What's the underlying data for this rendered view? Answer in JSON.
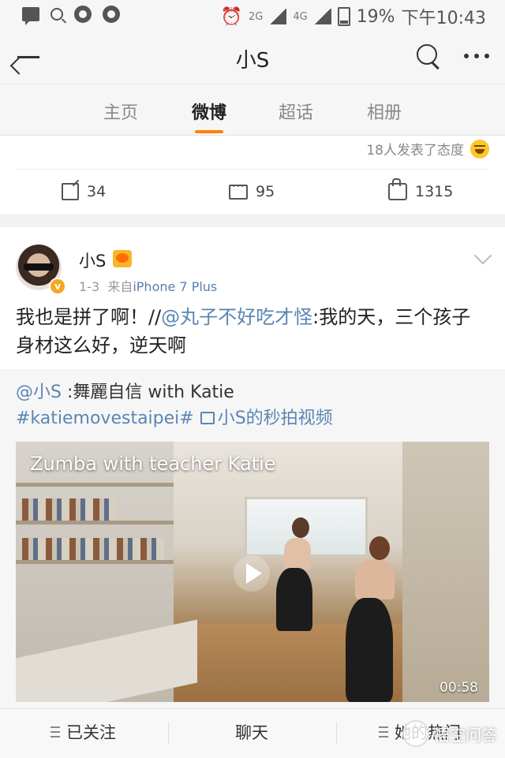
{
  "status_bar": {
    "network_2g": "2G",
    "network_4g": "4G",
    "battery": "19%",
    "time": "下午10:43"
  },
  "title_bar": {
    "title": "小S"
  },
  "tabs": [
    {
      "label": "主页",
      "active": false
    },
    {
      "label": "微博",
      "active": true
    },
    {
      "label": "超话",
      "active": false
    },
    {
      "label": "相册",
      "active": false
    }
  ],
  "prev_post": {
    "reactions_text": "18人发表了态度",
    "repost_count": "34",
    "comment_count": "95",
    "like_count": "1315"
  },
  "post": {
    "author": "小S",
    "date": "1-3",
    "source_prefix": "来自",
    "source": "iPhone 7 Plus",
    "text_before": "我也是拼了啊！//",
    "mention": "@丸子不好吃才怪",
    "text_after": ":我的天，三个孩子身材这么好，逆天啊"
  },
  "repost": {
    "mention": "@小S",
    "text": " :舞麗自信 with Katie",
    "hashtag": "#katiemovestaipei#",
    "video_link": "小S的秒拍视频",
    "video_title": "Zumba with teacher Katie",
    "duration": "00:58"
  },
  "bottom_bar": {
    "follow": "已关注",
    "chat": "聊天",
    "hot": "她的热门"
  },
  "watermark": "悟空问答",
  "colors": {
    "accent": "#ff8200",
    "link": "#5a86b4"
  }
}
